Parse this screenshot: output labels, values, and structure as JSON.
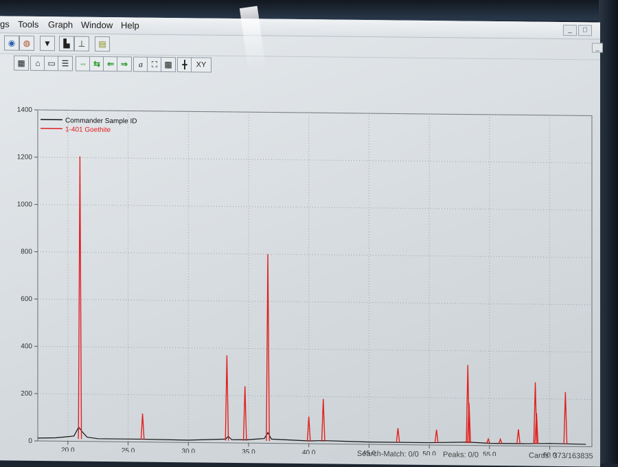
{
  "menubar": {
    "items": [
      "gs",
      "Tools",
      "Graph",
      "Window",
      "Help"
    ]
  },
  "window_controls": {
    "minimize": "_",
    "restore": "□",
    "close": "✕",
    "inner_minimize": "_",
    "inner_restore": "□",
    "inner_close": "✕"
  },
  "toolbar": {
    "xy_label": "XY",
    "text_tool_label": "a"
  },
  "status_bar": {
    "search_match": "Search-Match: 0/0",
    "peaks": "Peaks: 0/0",
    "cards": "Cards: 373/163835"
  },
  "chart_data": {
    "type": "line",
    "title": "",
    "xlabel": "",
    "ylabel": "",
    "xlim": [
      17.5,
      63.5
    ],
    "ylim": [
      0,
      1400
    ],
    "xticks": [
      20.0,
      25.0,
      30.0,
      35.0,
      40.0,
      45.0,
      50.0,
      55.0,
      60.0
    ],
    "xtick_labels": [
      "20.0",
      "25.0",
      "30.0",
      "35.0",
      "40.0",
      "45.0",
      "50.0",
      "55.0",
      "60.0"
    ],
    "yticks": [
      0,
      200,
      400,
      600,
      800,
      1000,
      1200,
      1400
    ],
    "ytick_labels": [
      "0",
      "200",
      "400",
      "600",
      "800",
      "1000",
      "1200",
      "1400"
    ],
    "grid": true,
    "legend_position": "top-left",
    "series": [
      {
        "name": "Commander Sample ID",
        "color": "#111111",
        "x": [
          17.5,
          19.0,
          20.5,
          20.9,
          21.2,
          21.6,
          22.5,
          26.0,
          30.0,
          33.1,
          33.3,
          33.6,
          34.8,
          36.3,
          36.6,
          36.9,
          40.0,
          41.2,
          45.0,
          50.0,
          53.2,
          55.0,
          58.0,
          60.0,
          63.0
        ],
        "y": [
          12,
          14,
          22,
          60,
          40,
          18,
          12,
          12,
          10,
          16,
          28,
          14,
          14,
          20,
          45,
          18,
          12,
          14,
          10,
          10,
          14,
          10,
          10,
          12,
          10
        ]
      },
      {
        "name": "1-401 Goethite",
        "color": "#e0201e",
        "peaks": [
          {
            "x": 21.0,
            "y": 1205
          },
          {
            "x": 26.2,
            "y": 120
          },
          {
            "x": 33.2,
            "y": 370
          },
          {
            "x": 34.7,
            "y": 240
          },
          {
            "x": 36.6,
            "y": 800
          },
          {
            "x": 40.0,
            "y": 115
          },
          {
            "x": 41.2,
            "y": 190
          },
          {
            "x": 47.4,
            "y": 70
          },
          {
            "x": 50.6,
            "y": 65
          },
          {
            "x": 53.2,
            "y": 340
          },
          {
            "x": 53.3,
            "y": 180
          },
          {
            "x": 54.9,
            "y": 28
          },
          {
            "x": 55.9,
            "y": 28
          },
          {
            "x": 57.4,
            "y": 70
          },
          {
            "x": 58.8,
            "y": 270
          },
          {
            "x": 58.9,
            "y": 140
          },
          {
            "x": 61.3,
            "y": 230
          }
        ]
      }
    ]
  }
}
